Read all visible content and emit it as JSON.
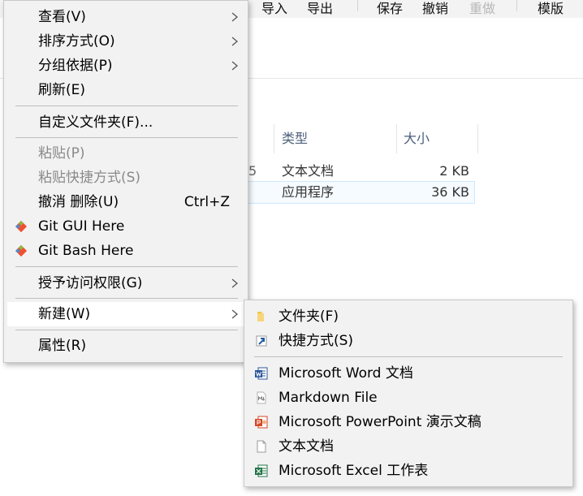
{
  "toolbar": {
    "import": "导入",
    "export": "导出",
    "save": "保存",
    "undo": "撤销",
    "redo": "重做",
    "template": "模版"
  },
  "columns": {
    "type": "类型",
    "size": "大小"
  },
  "rows": [
    {
      "fragment": "5",
      "type": "文本文档",
      "size": "2 KB"
    },
    {
      "fragment": "",
      "type": "应用程序",
      "size": "36 KB"
    }
  ],
  "context_menu": {
    "view": "查看(V)",
    "sort": "排序方式(O)",
    "group": "分组依据(P)",
    "refresh": "刷新(E)",
    "customize": "自定义文件夹(F)...",
    "paste": "粘贴(P)",
    "paste_shortcut": "粘贴快捷方式(S)",
    "undo_delete": "撤消 删除(U)",
    "undo_shortcut": "Ctrl+Z",
    "git_gui": "Git GUI Here",
    "git_bash": "Git Bash Here",
    "grant_access": "授予访问权限(G)",
    "new": "新建(W)",
    "properties": "属性(R)"
  },
  "submenu_new": {
    "folder": "文件夹(F)",
    "shortcut": "快捷方式(S)",
    "word": "Microsoft Word 文档",
    "markdown": "Markdown File",
    "powerpoint": "Microsoft PowerPoint 演示文稿",
    "text": "文本文档",
    "excel": "Microsoft Excel 工作表"
  },
  "icons": {
    "submenu_arrow": "chevron-right-icon",
    "git": "git-diamond-icon",
    "folder": "folder-icon",
    "shortcut": "shortcut-arrow-icon",
    "word": "word-doc-icon",
    "markdown": "markdown-file-icon",
    "powerpoint": "powerpoint-icon",
    "text": "text-file-icon",
    "excel": "excel-icon"
  },
  "colors": {
    "menu_bg": "#f2f2f2",
    "hover_bg": "#ffffff",
    "disabled_text": "#8a8a8a",
    "word": "#2b579a",
    "powerpoint": "#d24726",
    "excel": "#217346",
    "folder": "#f0c24e",
    "git": "#f05133"
  }
}
